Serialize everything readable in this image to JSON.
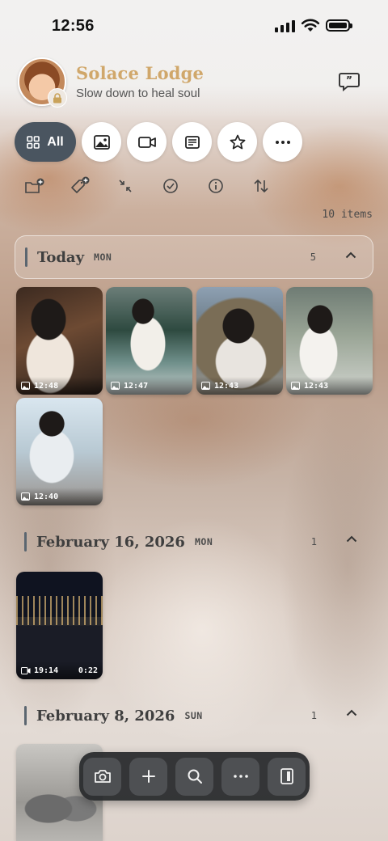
{
  "status_bar": {
    "time": "12:56"
  },
  "header": {
    "brand": "Solace Lodge",
    "tagline": "Slow down to heal soul"
  },
  "filters": [
    {
      "label": "All",
      "icon": "grid-icon",
      "active": true
    },
    {
      "icon": "image-icon"
    },
    {
      "icon": "video-icon"
    },
    {
      "icon": "note-icon"
    },
    {
      "icon": "star-icon"
    },
    {
      "icon": "more-icon"
    }
  ],
  "toolbar": [
    "new-folder-icon",
    "add-tag-icon",
    "collapse-icon",
    "select-icon",
    "info-icon",
    "sort-icon"
  ],
  "item_count": "10 items",
  "sections": [
    {
      "title": "Today",
      "day": "MON",
      "count": "5",
      "items": [
        {
          "type": "photo",
          "time": "12:48"
        },
        {
          "type": "photo",
          "time": "12:47"
        },
        {
          "type": "photo",
          "time": "12:43"
        },
        {
          "type": "photo",
          "time": "12:43"
        },
        {
          "type": "photo",
          "time": "12:40"
        }
      ]
    },
    {
      "title": "February 16, 2026",
      "day": "MON",
      "count": "1",
      "items": [
        {
          "type": "video",
          "time": "19:14",
          "duration": "0:22"
        }
      ]
    },
    {
      "title": "February 8, 2026",
      "day": "SUN",
      "count": "1",
      "items": [
        {
          "type": "photo"
        }
      ]
    }
  ],
  "dock": [
    "camera-icon",
    "plus-icon",
    "search-icon",
    "more-icon",
    "sidebar-icon"
  ]
}
